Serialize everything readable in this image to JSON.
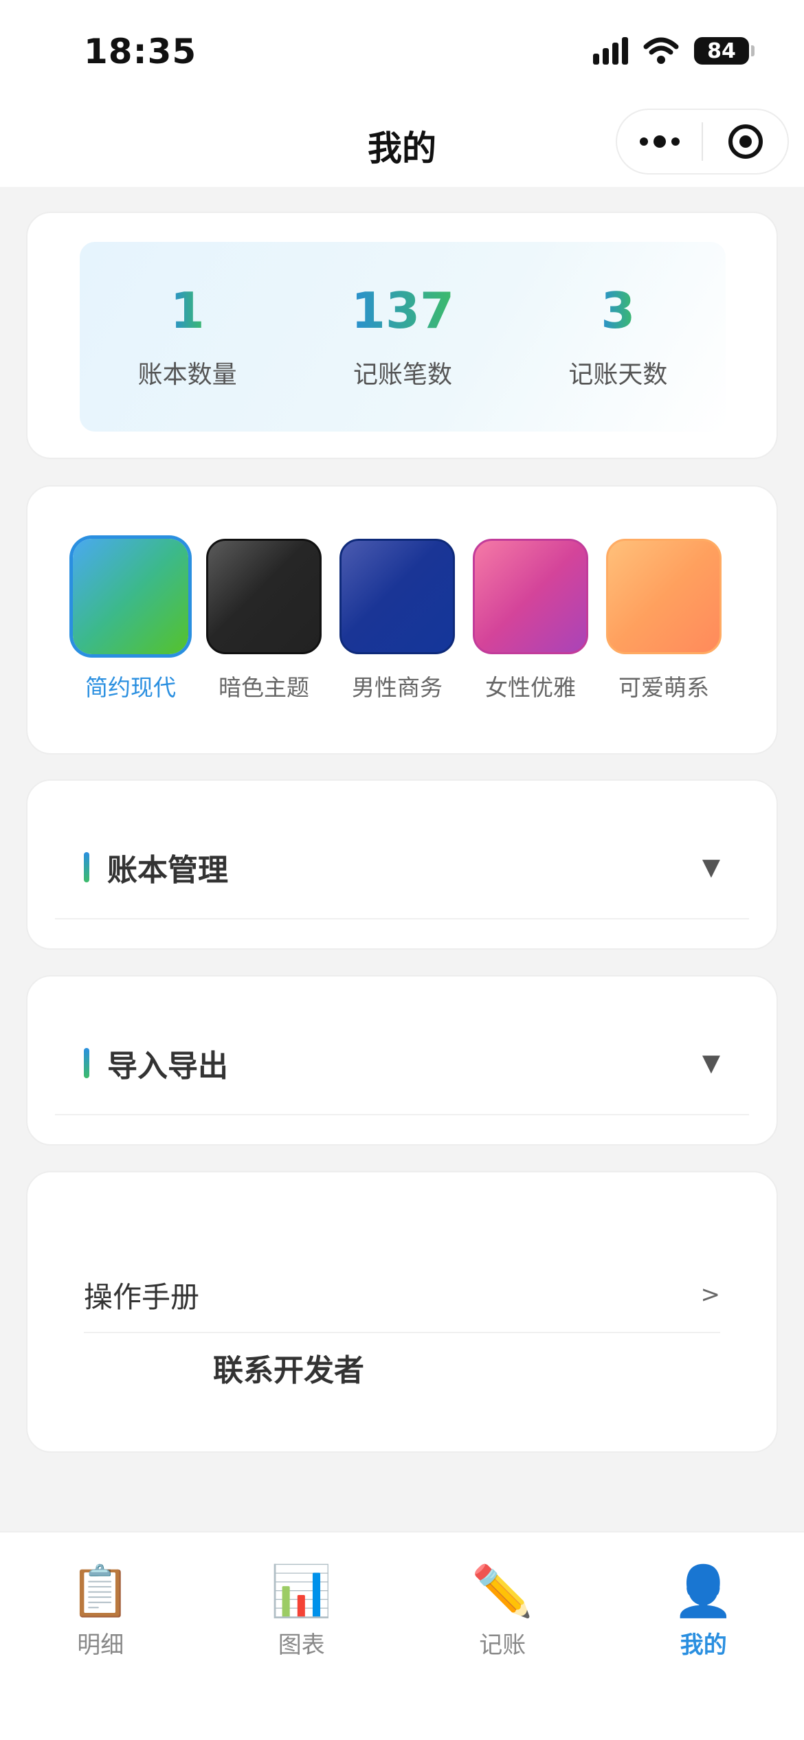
{
  "status_bar": {
    "time": "18:35",
    "battery": "84"
  },
  "nav": {
    "title": "我的"
  },
  "stats": [
    {
      "value": "1",
      "label": "账本数量"
    },
    {
      "value": "137",
      "label": "记账笔数"
    },
    {
      "value": "3",
      "label": "记账天数"
    }
  ],
  "themes": [
    {
      "label": "简约现代",
      "active": true
    },
    {
      "label": "暗色主题"
    },
    {
      "label": "男性商务"
    },
    {
      "label": "女性优雅"
    },
    {
      "label": "可爱萌系"
    }
  ],
  "sections": {
    "ledger": {
      "title": "账本管理",
      "caret": "▼"
    },
    "import_export": {
      "title": "导入导出",
      "caret": "▼"
    }
  },
  "links": {
    "manual": {
      "label": "操作手册",
      "chevron": ">"
    },
    "contact": {
      "label": "联系开发者"
    }
  },
  "tabs": [
    {
      "label": "明细",
      "icon": "clipboard-icon",
      "glyph": "📋"
    },
    {
      "label": "图表",
      "icon": "bar-chart-icon",
      "glyph": "📊"
    },
    {
      "label": "记账",
      "icon": "pencil-icon",
      "glyph": "✏️"
    },
    {
      "label": "我的",
      "icon": "user-icon",
      "glyph": "👤",
      "active": true
    }
  ],
  "colors": {
    "accent": "#2a8fe0",
    "accent_green": "#3dbb6a"
  }
}
